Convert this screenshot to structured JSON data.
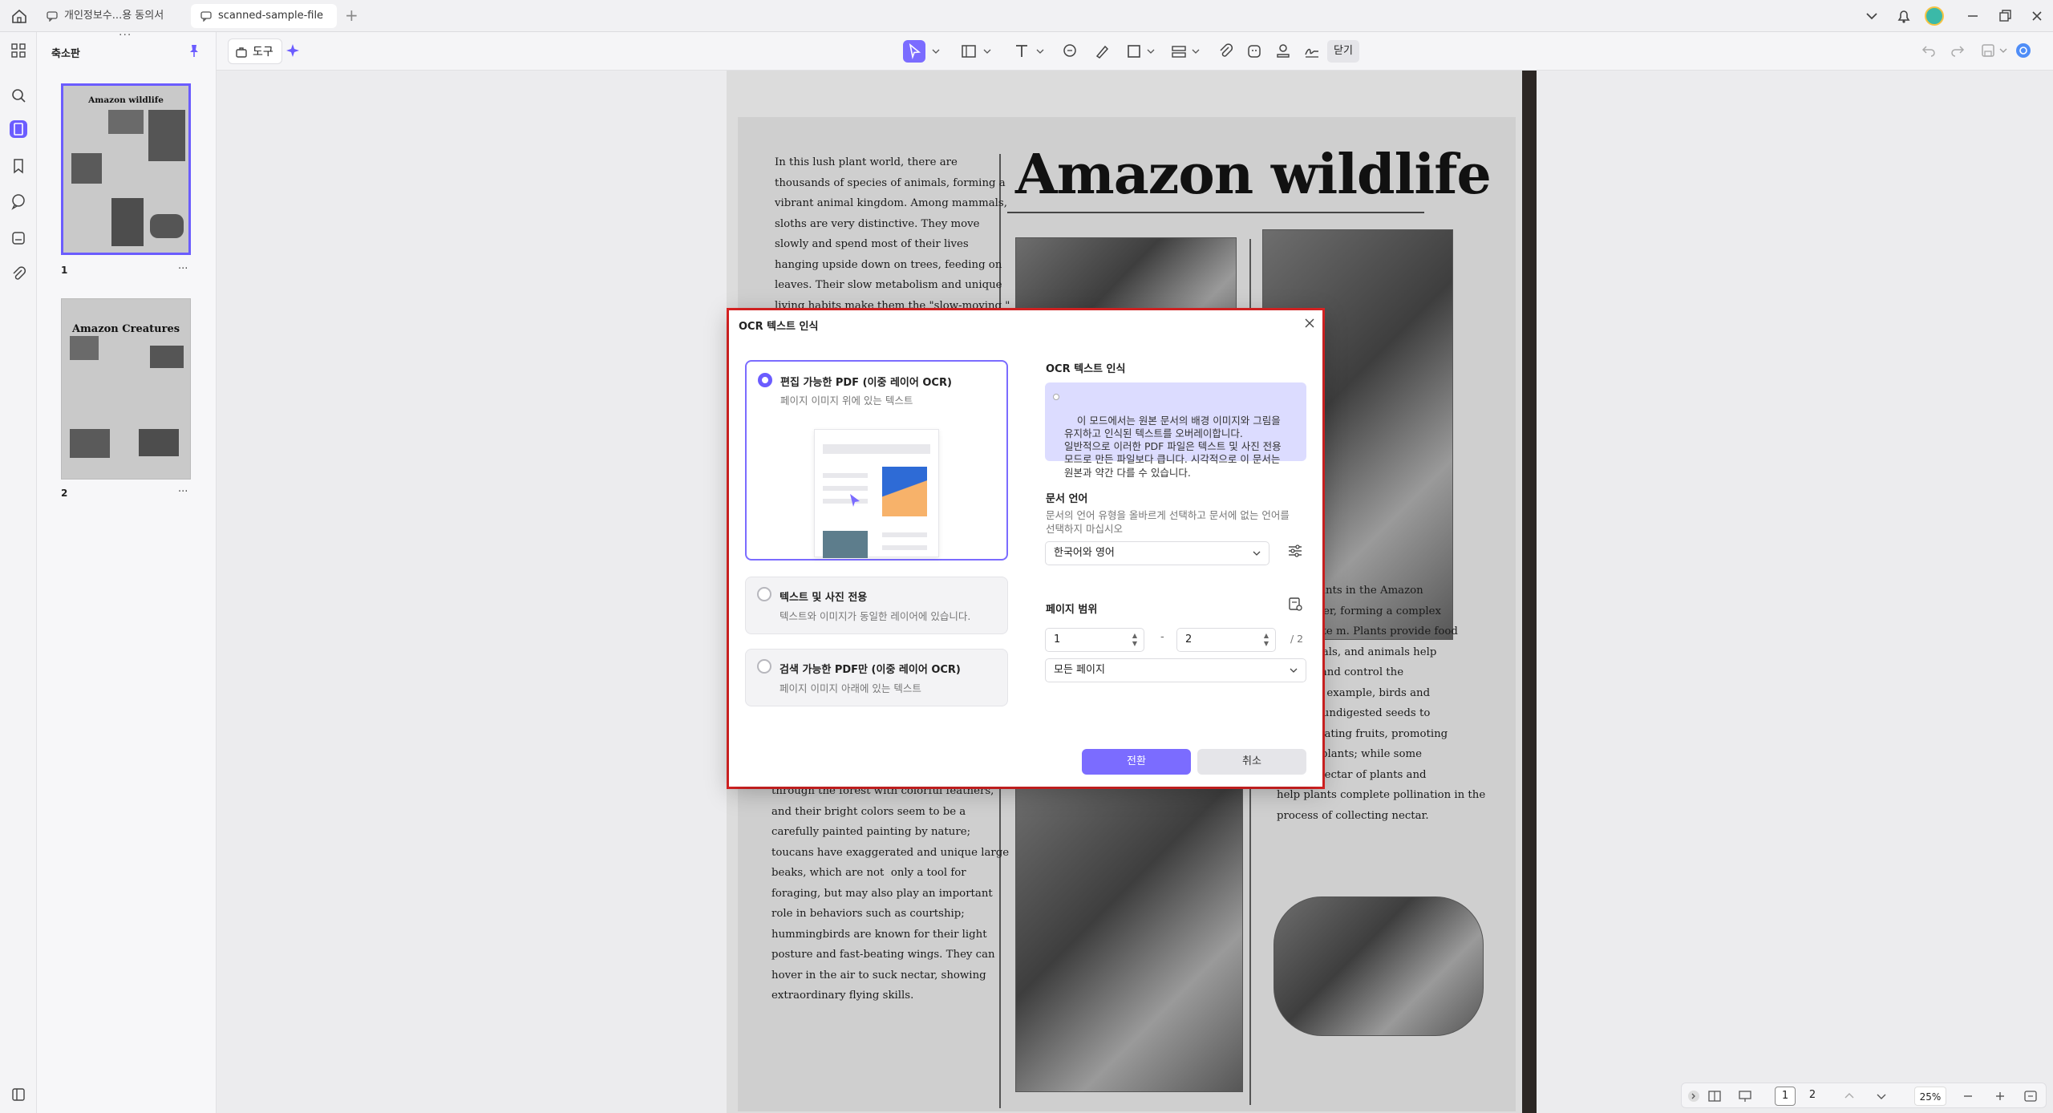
{
  "tabs": [
    {
      "label": "개인정보수...용 동의서"
    },
    {
      "label": "scanned-sample-file"
    }
  ],
  "sidebar": {
    "title": "축소판",
    "thumbnails": [
      {
        "title": "Amazon wildlife",
        "page": "1"
      },
      {
        "title": "Amazon Creatures",
        "page": "2"
      }
    ],
    "more": "···"
  },
  "toolbar": {
    "tool_label": "도구",
    "close_label": "닫기"
  },
  "document": {
    "title": "Amazon wildlife",
    "col1_top": "In this lush plant world, there are\nthousands of species of animals, forming a\nvibrant animal kingdom. Among mammals,\nsloths are very distinctive. They move\nslowly and spend most of their lives\nhanging upside down on trees, feeding on\nleaves. Their slow metabolism and unique\nliving habits make them the \"slow-moving \"",
    "col1_bottom": "through the forest with colorful feathers,\nand their bright colors seem to be a\ncarefully painted painting by nature;\ntoucans have exaggerated and unique large\nbeaks, which are not  only a tool for\nforaging, but may also play an important\nrole in behaviors such as courtship;\nhummingbirds are known for their light\nposture and fast-beating wings. They can\nhover in the air to suck nectar, showing\nextraordinary flying skills.",
    "col3_bottom": "s and plants in the Amazon\neach other, forming a complex\ne ecosyste m. Plants provide food\nfor animals, and animals help\nd seeds and control the\nests. For example, birds and\nill carry undigested seeds to\ns while eating fruits, promoting\nction of plants; while some\n on the nectar of plants and\nhelp plants complete pollination in the\nprocess of collecting nectar."
  },
  "dialog": {
    "title": "OCR 텍스트 인식",
    "options": [
      {
        "title": "편집 가능한 PDF (이중 레이어 OCR)",
        "subtitle": "페이지 이미지 위에 있는 텍스트",
        "selected": true
      },
      {
        "title": "텍스트 및 사진 전용",
        "subtitle": "텍스트와 이미지가 동일한 레이어에 있습니다.",
        "selected": false
      },
      {
        "title": "검색 가능한 PDF만 (이중 레이어 OCR)",
        "subtitle": "페이지 이미지 아래에 있는 텍스트",
        "selected": false
      }
    ],
    "right_title": "OCR 텍스트 인식",
    "info_text": "이 모드에서는 원본 문서의 배경 이미지와 그림을\n유지하고 인식된 텍스트를 오버레이합니다.\n일반적으로 이러한 PDF 파일은 텍스트 및 사진 전용\n모드로 만든 파일보다 큽니다. 시각적으로 이 문서는\n원본과 약간 다를 수 있습니다.",
    "language_title": "문서 언어",
    "language_hint": "문서의 언어 유형을 올바르게 선택하고 문서에 없는 언어를\n선택하지 마십시오",
    "language_value": "한국어와 영어",
    "range_title": "페이지 범위",
    "range_from": "1",
    "range_dash": "-",
    "range_to": "2",
    "range_total": "/ 2",
    "pages_value": "모든 페이지",
    "convert_label": "전환",
    "cancel_label": "취소"
  },
  "bottom": {
    "page1": "1",
    "page2": "2",
    "zoom": "25%"
  },
  "colors": {
    "accent": "#7b6cff",
    "highlight_border": "#e02424"
  }
}
